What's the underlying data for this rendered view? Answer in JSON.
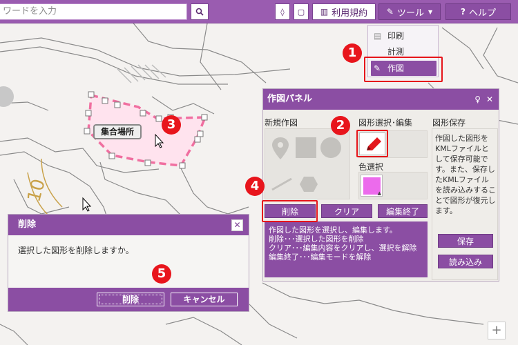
{
  "search": {
    "placeholder": "ワードを入力"
  },
  "toolbar": {
    "terms_label": "利用規約",
    "tools_label": "ツール",
    "help_label": "ヘルプ"
  },
  "tool_menu": {
    "items": [
      {
        "label": "印刷",
        "icon": "print-icon"
      },
      {
        "label": "計測",
        "icon": "ruler-icon"
      },
      {
        "label": "作図",
        "icon": "pencil-icon",
        "selected": true
      }
    ]
  },
  "steps": [
    "1",
    "2",
    "3",
    "4",
    "5"
  ],
  "map": {
    "feature_label": "集合場所",
    "contour_label": "10"
  },
  "draw_panel": {
    "title": "作図パネル",
    "new_drawing_label": "新規作図",
    "select_edit_label": "図形選択･編集",
    "color_select_label": "色選択",
    "save_section_label": "図形保存",
    "delete_label": "削除",
    "clear_label": "クリア",
    "end_edit_label": "編集終了",
    "help_lines": [
      "作図した図形を選択し、編集します。",
      "削除･･･選択した図形を削除",
      "クリア･･･編集内容をクリアし、選択を解除",
      "編集終了･･･編集モードを解除"
    ],
    "save_description": "作図した図形をKMLファイルとして保存可能です。また、保存したKMLファイルを読み込みすることで図形が復元します。",
    "save_label": "保存",
    "load_label": "読み込み",
    "selected_color": "#ec6bec"
  },
  "dialog": {
    "title": "削除",
    "message": "選択した図形を削除しますか。",
    "delete_label": "削除",
    "cancel_label": "キャンセル"
  },
  "colors": {
    "accent": "#8b4ea3",
    "highlight": "#e6141a"
  }
}
